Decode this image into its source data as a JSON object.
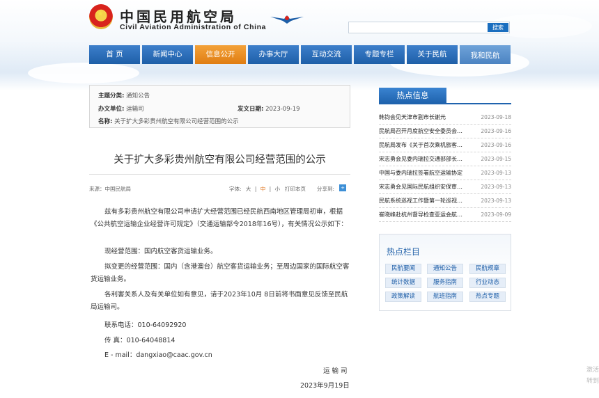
{
  "site": {
    "title_cn": "中国民用航空局",
    "title_en": "Civil Aviation Administration of China"
  },
  "search": {
    "placeholder": "",
    "button": "搜索"
  },
  "nav": [
    {
      "label": "首 页"
    },
    {
      "label": "新闻中心"
    },
    {
      "label": "信息公开"
    },
    {
      "label": "办事大厅"
    },
    {
      "label": "互动交流"
    },
    {
      "label": "专题专栏"
    },
    {
      "label": "关于民航"
    },
    {
      "label": "我和民航"
    }
  ],
  "meta": {
    "subject_label": "主题分类:",
    "subject": "通知公告",
    "issuer_label": "办文单位:",
    "issuer": "运输司",
    "date_label": "发文日期:",
    "date": "2023-09-19",
    "name_label": "名称:",
    "name": "关于扩大多彩贵州航空有限公司经营范围的公示"
  },
  "article": {
    "title": "关于扩大多彩贵州航空有限公司经营范围的公示",
    "source": "来源：中国民航局",
    "font_label": "字体:",
    "font_large": "大",
    "font_medium": "中",
    "font_small": "小",
    "sep": "|",
    "print": "打印本页",
    "share": "分享到:",
    "p1": "兹有多彩贵州航空有限公司申请扩大经营范围已经民航西南地区管理局初审，根据《公共航空运输企业经营许可规定》（交通运输部令2018年16号），有关情况公示如下：",
    "p2": "现经营范围：国内航空客货运输业务。",
    "p3": "拟变更的经营范围：国内（含港澳台）航空客货运输业务；至周边国家的国际航空客货运输业务。",
    "p4": "各利害关系人及有关单位如有意见，请于2023年10月 8日前将书面意见反馈至民航局运输司。",
    "phone": "联系电话：010-64092920",
    "fax": "传 真：010-64048814",
    "email": "E - mail：dangxiao@caac.gov.cn",
    "signer": "运 输 司",
    "sign_date": "2023年9月19日"
  },
  "hot_info": {
    "title": "热点信息",
    "items": [
      {
        "title": "韩钧会见天津市副市长谢元",
        "date": "2023-09-18"
      },
      {
        "title": "民航局召开月度航空安全委员会…",
        "date": "2023-09-16"
      },
      {
        "title": "民航局发布《关于首次乘机旅客…",
        "date": "2023-09-16"
      },
      {
        "title": "宋志勇会见委内瑞拉交通部部长…",
        "date": "2023-09-15"
      },
      {
        "title": "中国与委内瑞拉签署航空运输协定",
        "date": "2023-09-13"
      },
      {
        "title": "宋志勇会见国际民航组织安保审…",
        "date": "2023-09-13"
      },
      {
        "title": "民航系统巡视工作暨第一轮巡视…",
        "date": "2023-09-13"
      },
      {
        "title": "崔晓峰赴杭州督导检查亚运会航…",
        "date": "2023-09-09"
      }
    ]
  },
  "hot_columns": {
    "title": "热点栏目",
    "items": [
      {
        "label": "民航要闻"
      },
      {
        "label": "通知公告"
      },
      {
        "label": "民航规章"
      },
      {
        "label": "统计数据"
      },
      {
        "label": "服务指南"
      },
      {
        "label": "行业动态"
      },
      {
        "label": "政策解读"
      },
      {
        "label": "航班指南"
      },
      {
        "label": "热点专题"
      }
    ]
  },
  "ghost_text": {
    "line1": "激活",
    "line2": "转到"
  },
  "colors": {
    "nav_blue": "#1e5fa8",
    "nav_active": "#e07d12",
    "accent": "#1f63ae"
  }
}
